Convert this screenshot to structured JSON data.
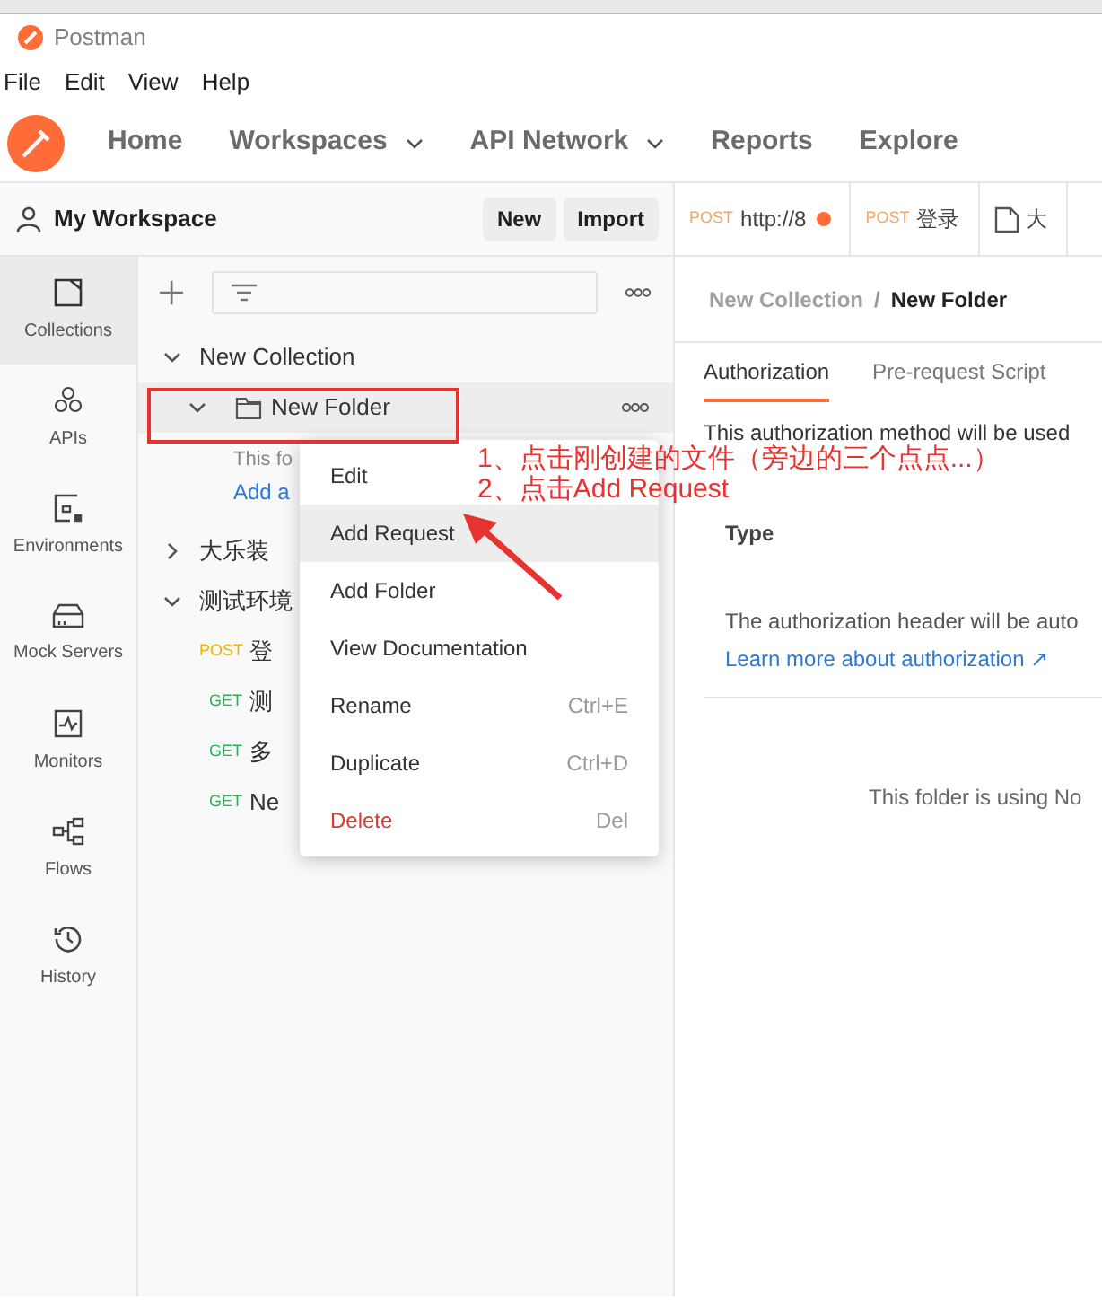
{
  "window": {
    "title": "Postman"
  },
  "menu_bar": [
    "File",
    "Edit",
    "View",
    "Help"
  ],
  "nav": [
    {
      "label": "Home",
      "dropdown": false
    },
    {
      "label": "Workspaces",
      "dropdown": true
    },
    {
      "label": "API Network",
      "dropdown": true
    },
    {
      "label": "Reports",
      "dropdown": false
    },
    {
      "label": "Explore",
      "dropdown": false
    }
  ],
  "workspace": {
    "name": "My Workspace",
    "buttons": [
      "New",
      "Import"
    ]
  },
  "request_tabs": [
    {
      "kind": "request",
      "method": "POST",
      "label": "http://8",
      "unsaved": true
    },
    {
      "kind": "request",
      "method": "POST",
      "label": "登录",
      "unsaved": false
    },
    {
      "kind": "folder",
      "label": "大"
    }
  ],
  "sidebar": [
    {
      "label": "Collections",
      "selected": true
    },
    {
      "label": "APIs",
      "selected": false
    },
    {
      "label": "Environments",
      "selected": false
    },
    {
      "label": "Mock Servers",
      "selected": false
    },
    {
      "label": "Monitors",
      "selected": false
    },
    {
      "label": "Flows",
      "selected": false
    },
    {
      "label": "History",
      "selected": false
    }
  ],
  "tree": [
    {
      "kind": "collection",
      "label": "New Collection",
      "expanded": true,
      "selected": false,
      "children": [
        {
          "kind": "folder",
          "label": "New Folder",
          "expanded": true,
          "selected": true,
          "children": [
            {
              "kind": "note",
              "label": "This fo"
            },
            {
              "kind": "link",
              "label": "Add a"
            }
          ]
        }
      ]
    },
    {
      "kind": "collection",
      "label": "大乐装",
      "expanded": false,
      "selected": false
    },
    {
      "kind": "collection",
      "label": "测试环境",
      "expanded": true,
      "selected": false,
      "children": [
        {
          "kind": "request",
          "method": "POST",
          "color": "#f0b400",
          "label": "登",
          "selected": false
        },
        {
          "kind": "request",
          "method": "GET",
          "color": "#22b35a",
          "label": "测",
          "selected": false
        },
        {
          "kind": "request",
          "method": "GET",
          "color": "#22b35a",
          "label": "多",
          "selected": false
        },
        {
          "kind": "request",
          "method": "GET",
          "color": "#22b35a",
          "label": "Ne",
          "selected": false
        }
      ]
    }
  ],
  "context_menu": [
    {
      "label": "Edit",
      "selected": false,
      "danger": false
    },
    {
      "label": "Add Request",
      "selected": true,
      "danger": false
    },
    {
      "label": "Add Folder",
      "selected": false,
      "danger": false
    },
    {
      "label": "View Documentation",
      "selected": false,
      "danger": false
    },
    {
      "label": "Rename",
      "shortcut": "Ctrl+E",
      "selected": false,
      "danger": false
    },
    {
      "label": "Duplicate",
      "shortcut": "Ctrl+D",
      "selected": false,
      "danger": false
    },
    {
      "label": "Delete",
      "shortcut": "Del",
      "selected": false,
      "danger": true
    }
  ],
  "annotations": [
    "1、点击刚创建的文件（旁边的三个点点...）",
    "2、点击Add Request"
  ],
  "detail": {
    "breadcrumb": [
      "New Collection",
      "New Folder"
    ],
    "breadcrumb_separator": "/",
    "tabs": [
      {
        "label": "Authorization",
        "selected": true
      },
      {
        "label": "Pre-request Script",
        "selected": false
      }
    ],
    "auth_note": "This authorization method will be used",
    "type_label": "Type",
    "header_note": "The authorization header will be auto",
    "learn_link": "Learn more about authorization ↗",
    "folder_note": "This folder is using No"
  }
}
